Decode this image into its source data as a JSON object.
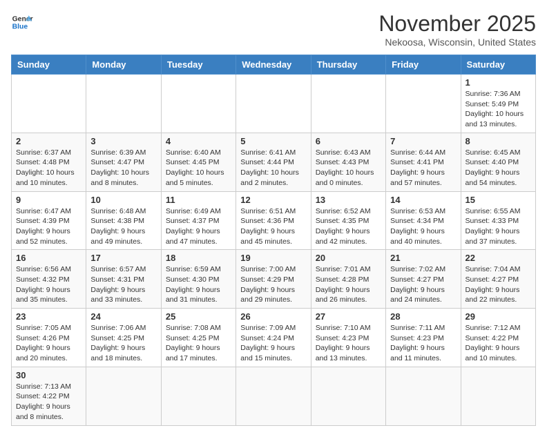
{
  "header": {
    "logo_text_general": "General",
    "logo_text_blue": "Blue",
    "month_title": "November 2025",
    "location": "Nekoosa, Wisconsin, United States"
  },
  "weekdays": [
    "Sunday",
    "Monday",
    "Tuesday",
    "Wednesday",
    "Thursday",
    "Friday",
    "Saturday"
  ],
  "weeks": [
    [
      {
        "day": "",
        "info": ""
      },
      {
        "day": "",
        "info": ""
      },
      {
        "day": "",
        "info": ""
      },
      {
        "day": "",
        "info": ""
      },
      {
        "day": "",
        "info": ""
      },
      {
        "day": "",
        "info": ""
      },
      {
        "day": "1",
        "info": "Sunrise: 7:36 AM\nSunset: 5:49 PM\nDaylight: 10 hours and 13 minutes."
      }
    ],
    [
      {
        "day": "2",
        "info": "Sunrise: 6:37 AM\nSunset: 4:48 PM\nDaylight: 10 hours and 10 minutes."
      },
      {
        "day": "3",
        "info": "Sunrise: 6:39 AM\nSunset: 4:47 PM\nDaylight: 10 hours and 8 minutes."
      },
      {
        "day": "4",
        "info": "Sunrise: 6:40 AM\nSunset: 4:45 PM\nDaylight: 10 hours and 5 minutes."
      },
      {
        "day": "5",
        "info": "Sunrise: 6:41 AM\nSunset: 4:44 PM\nDaylight: 10 hours and 2 minutes."
      },
      {
        "day": "6",
        "info": "Sunrise: 6:43 AM\nSunset: 4:43 PM\nDaylight: 10 hours and 0 minutes."
      },
      {
        "day": "7",
        "info": "Sunrise: 6:44 AM\nSunset: 4:41 PM\nDaylight: 9 hours and 57 minutes."
      },
      {
        "day": "8",
        "info": "Sunrise: 6:45 AM\nSunset: 4:40 PM\nDaylight: 9 hours and 54 minutes."
      }
    ],
    [
      {
        "day": "9",
        "info": "Sunrise: 6:47 AM\nSunset: 4:39 PM\nDaylight: 9 hours and 52 minutes."
      },
      {
        "day": "10",
        "info": "Sunrise: 6:48 AM\nSunset: 4:38 PM\nDaylight: 9 hours and 49 minutes."
      },
      {
        "day": "11",
        "info": "Sunrise: 6:49 AM\nSunset: 4:37 PM\nDaylight: 9 hours and 47 minutes."
      },
      {
        "day": "12",
        "info": "Sunrise: 6:51 AM\nSunset: 4:36 PM\nDaylight: 9 hours and 45 minutes."
      },
      {
        "day": "13",
        "info": "Sunrise: 6:52 AM\nSunset: 4:35 PM\nDaylight: 9 hours and 42 minutes."
      },
      {
        "day": "14",
        "info": "Sunrise: 6:53 AM\nSunset: 4:34 PM\nDaylight: 9 hours and 40 minutes."
      },
      {
        "day": "15",
        "info": "Sunrise: 6:55 AM\nSunset: 4:33 PM\nDaylight: 9 hours and 37 minutes."
      }
    ],
    [
      {
        "day": "16",
        "info": "Sunrise: 6:56 AM\nSunset: 4:32 PM\nDaylight: 9 hours and 35 minutes."
      },
      {
        "day": "17",
        "info": "Sunrise: 6:57 AM\nSunset: 4:31 PM\nDaylight: 9 hours and 33 minutes."
      },
      {
        "day": "18",
        "info": "Sunrise: 6:59 AM\nSunset: 4:30 PM\nDaylight: 9 hours and 31 minutes."
      },
      {
        "day": "19",
        "info": "Sunrise: 7:00 AM\nSunset: 4:29 PM\nDaylight: 9 hours and 29 minutes."
      },
      {
        "day": "20",
        "info": "Sunrise: 7:01 AM\nSunset: 4:28 PM\nDaylight: 9 hours and 26 minutes."
      },
      {
        "day": "21",
        "info": "Sunrise: 7:02 AM\nSunset: 4:27 PM\nDaylight: 9 hours and 24 minutes."
      },
      {
        "day": "22",
        "info": "Sunrise: 7:04 AM\nSunset: 4:27 PM\nDaylight: 9 hours and 22 minutes."
      }
    ],
    [
      {
        "day": "23",
        "info": "Sunrise: 7:05 AM\nSunset: 4:26 PM\nDaylight: 9 hours and 20 minutes."
      },
      {
        "day": "24",
        "info": "Sunrise: 7:06 AM\nSunset: 4:25 PM\nDaylight: 9 hours and 18 minutes."
      },
      {
        "day": "25",
        "info": "Sunrise: 7:08 AM\nSunset: 4:25 PM\nDaylight: 9 hours and 17 minutes."
      },
      {
        "day": "26",
        "info": "Sunrise: 7:09 AM\nSunset: 4:24 PM\nDaylight: 9 hours and 15 minutes."
      },
      {
        "day": "27",
        "info": "Sunrise: 7:10 AM\nSunset: 4:23 PM\nDaylight: 9 hours and 13 minutes."
      },
      {
        "day": "28",
        "info": "Sunrise: 7:11 AM\nSunset: 4:23 PM\nDaylight: 9 hours and 11 minutes."
      },
      {
        "day": "29",
        "info": "Sunrise: 7:12 AM\nSunset: 4:22 PM\nDaylight: 9 hours and 10 minutes."
      }
    ],
    [
      {
        "day": "30",
        "info": "Sunrise: 7:13 AM\nSunset: 4:22 PM\nDaylight: 9 hours and 8 minutes."
      },
      {
        "day": "",
        "info": ""
      },
      {
        "day": "",
        "info": ""
      },
      {
        "day": "",
        "info": ""
      },
      {
        "day": "",
        "info": ""
      },
      {
        "day": "",
        "info": ""
      },
      {
        "day": "",
        "info": ""
      }
    ]
  ]
}
